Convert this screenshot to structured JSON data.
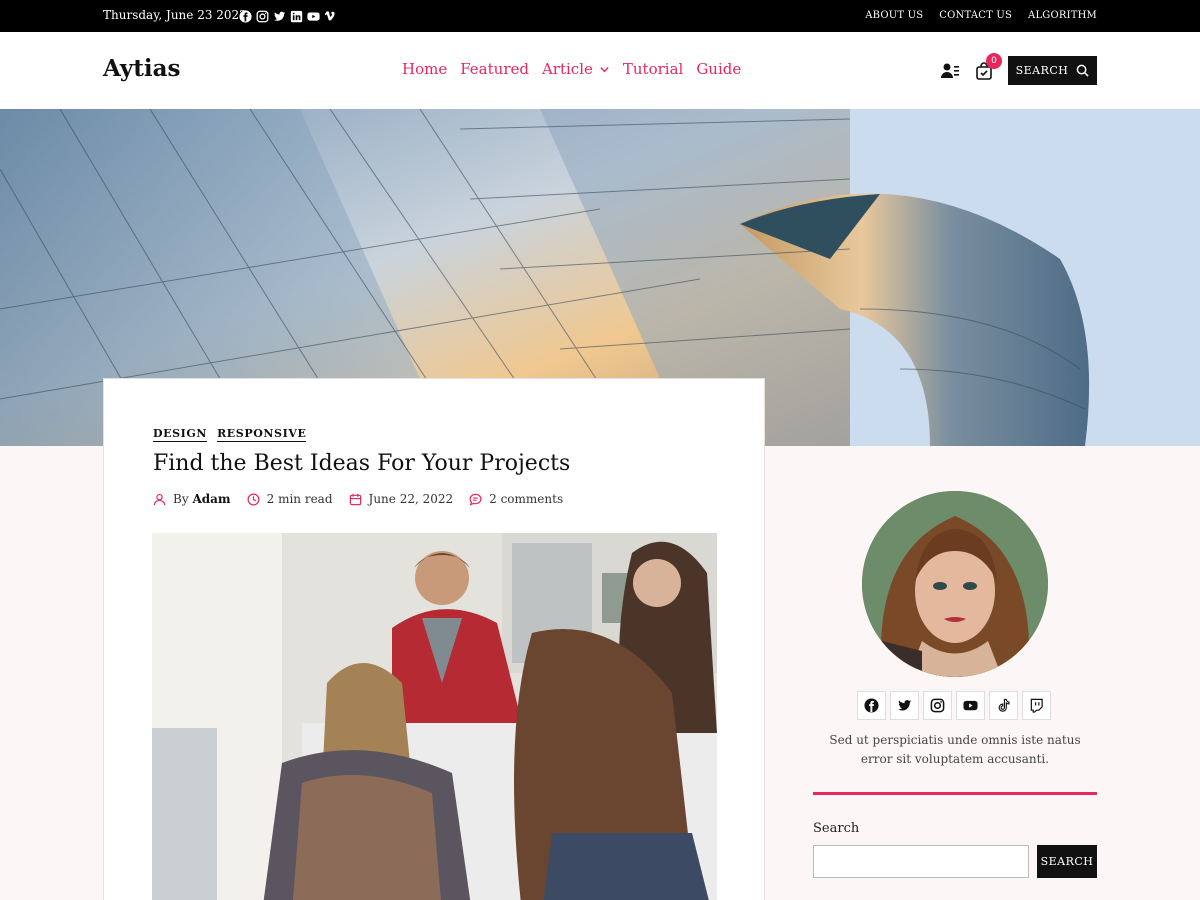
{
  "topbar": {
    "date": "Thursday, June 23 2022",
    "social_icons": [
      "facebook-icon",
      "instagram-icon",
      "twitter-icon",
      "linkedin-icon",
      "youtube-icon",
      "vimeo-icon"
    ],
    "links": [
      "ABOUT US",
      "CONTACT US",
      "ALGORITHM"
    ]
  },
  "header": {
    "logo": "Aytias",
    "nav": [
      "Home",
      "Featured",
      "Article",
      "Tutorial",
      "Guide"
    ],
    "cart_count": "0",
    "search_label": "SEARCH"
  },
  "article": {
    "categories": [
      "DESIGN",
      "RESPONSIVE"
    ],
    "title": "Find the Best Ideas For Your Projects",
    "by_prefix": "By",
    "author": "Adam",
    "read_time": "2 min read",
    "date": "June 22, 2022",
    "comments": "2 comments"
  },
  "sidebar": {
    "social_icons": [
      "facebook-icon",
      "twitter-icon",
      "instagram-icon",
      "youtube-icon",
      "tiktok-icon",
      "twitch-icon"
    ],
    "bio": "Sed ut perspiciatis unde omnis iste natus error sit voluptatem accusanti.",
    "search_title": "Search",
    "search_button": "SEARCH"
  },
  "colors": {
    "accent": "#e8285c",
    "topbar_bg": "#000000",
    "lower_bg": "#fdf6f6"
  }
}
